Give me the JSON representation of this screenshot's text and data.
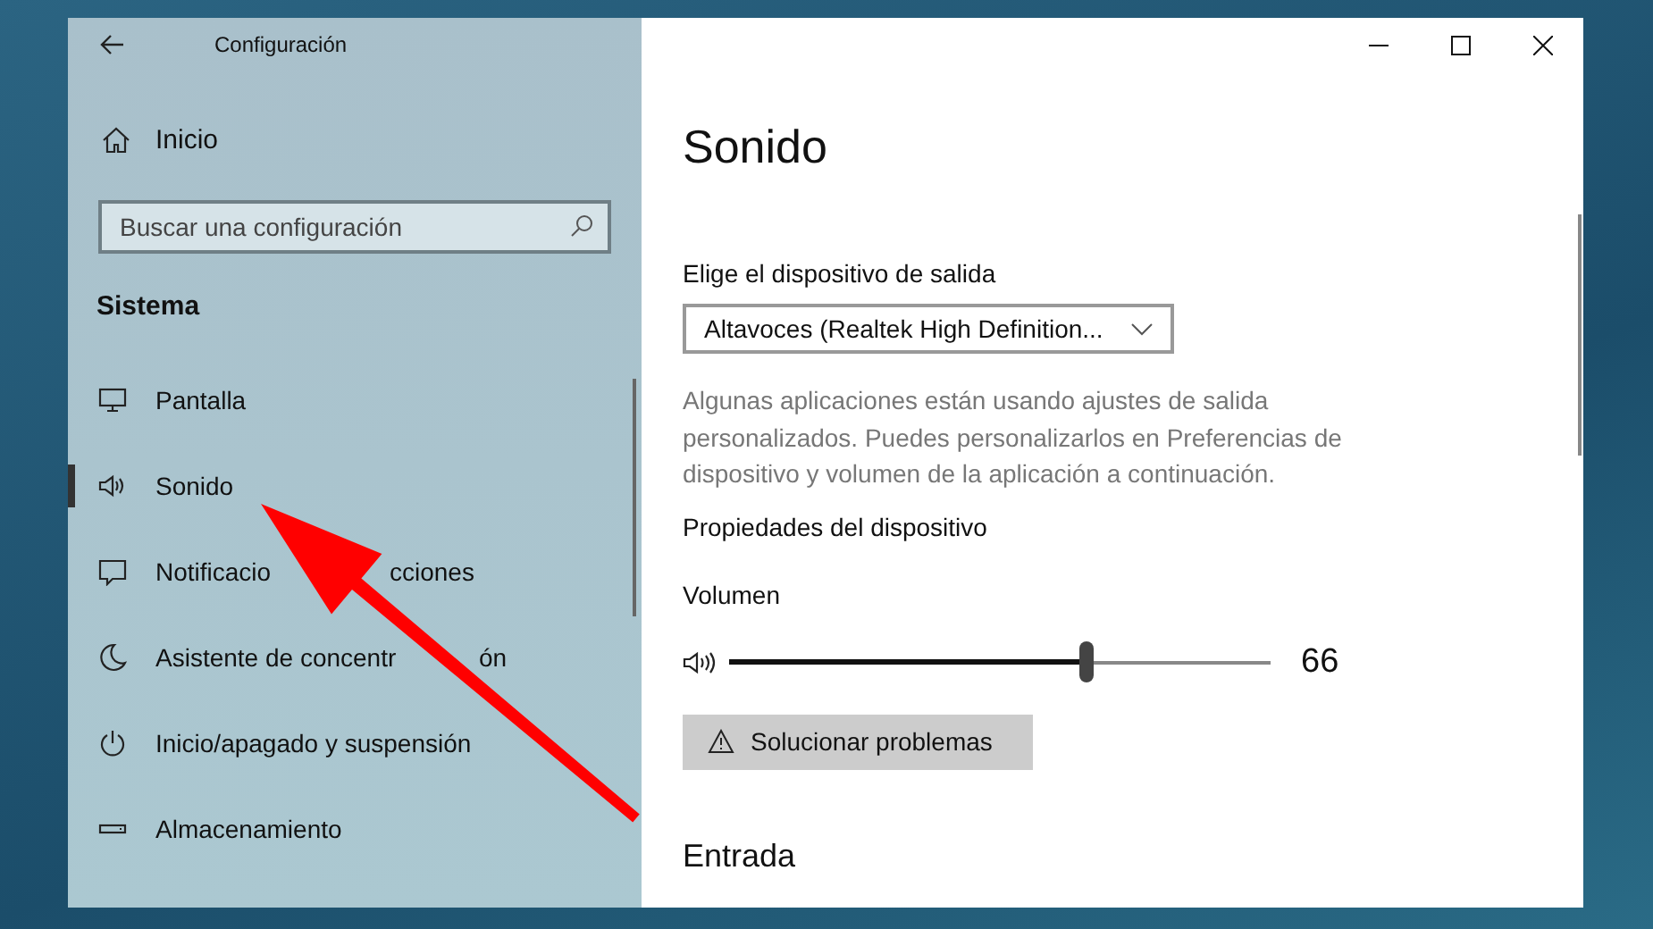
{
  "window": {
    "title": "Configuración",
    "controls": [
      {
        "kind": "minimize"
      },
      {
        "kind": "maximize"
      },
      {
        "kind": "close"
      }
    ]
  },
  "sidebar": {
    "home": {
      "label": "Inicio"
    },
    "search": {
      "placeholder": "Buscar una configuración"
    },
    "section": "Sistema",
    "items": [
      {
        "kind": "display",
        "parts": [
          "Pantalla"
        ],
        "selected": false
      },
      {
        "kind": "speaker",
        "parts": [
          "Sonido"
        ],
        "selected": true
      },
      {
        "kind": "message",
        "parts": [
          "Notificacio",
          "cciones"
        ],
        "selected": false
      },
      {
        "kind": "moon",
        "parts": [
          "Asistente de concentr",
          "ón"
        ],
        "selected": false
      },
      {
        "kind": "power",
        "parts": [
          "Inicio/apagado y suspensión"
        ],
        "selected": false
      },
      {
        "kind": "storage",
        "parts": [
          "Almacenamiento"
        ],
        "selected": false
      }
    ]
  },
  "content": {
    "title": "Sonido",
    "output_label": "Elige el dispositivo de salida",
    "output_device": "Altavoces (Realtek High Definition...",
    "note": "Algunas aplicaciones están usando ajustes de salida personalizados. Puedes personalizarlos en Preferencias de dispositivo y volumen de la aplicación a continuación.",
    "properties_link": "Propiedades del dispositivo",
    "volume": {
      "label": "Volumen",
      "level": 0.66,
      "reading": "66"
    },
    "troubleshoot_button": "Solucionar problemas",
    "next_section": "Entrada"
  }
}
